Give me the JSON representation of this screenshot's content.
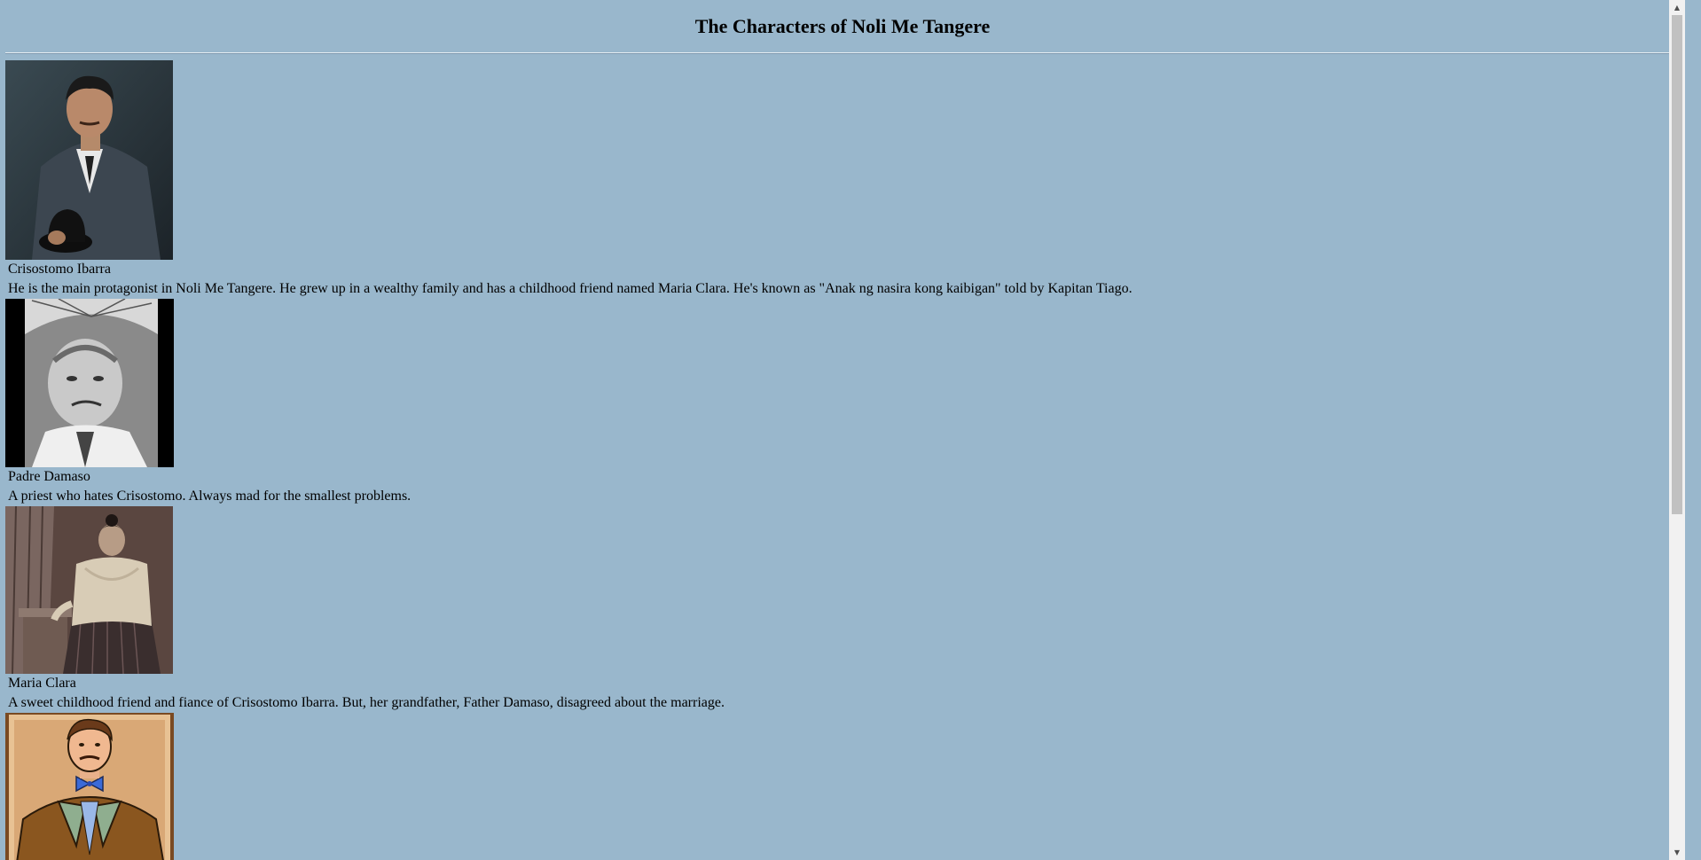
{
  "title": "The Characters of Noli Me Tangere",
  "characters": [
    {
      "name": "Crisostomo Ibarra",
      "description": "He is the main protagonist in Noli Me Tangere. He grew up in a wealthy family and has a childhood friend named Maria Clara. He's known as \"Anak ng nasira kong kaibigan\" told by Kapitan Tiago.",
      "portrait_icon": "portrait-photo-man-in-suit"
    },
    {
      "name": "Padre Damaso",
      "description": "A priest who hates Crisostomo. Always mad for the smallest problems.",
      "portrait_icon": "portrait-photo-black-and-white-man"
    },
    {
      "name": "Maria Clara",
      "description": "A sweet childhood friend and fiance of Crisostomo Ibarra. But, her grandfather, Father Damaso, disagreed about the marriage.",
      "portrait_icon": "portrait-photo-woman-in-filipiniana"
    },
    {
      "name": "",
      "description": "",
      "portrait_icon": "portrait-cartoon-man-bowtie"
    }
  ],
  "scrollbar": {
    "up_glyph": "▲",
    "down_glyph": "▼"
  },
  "colors": {
    "page_background": "#99b7cc"
  }
}
